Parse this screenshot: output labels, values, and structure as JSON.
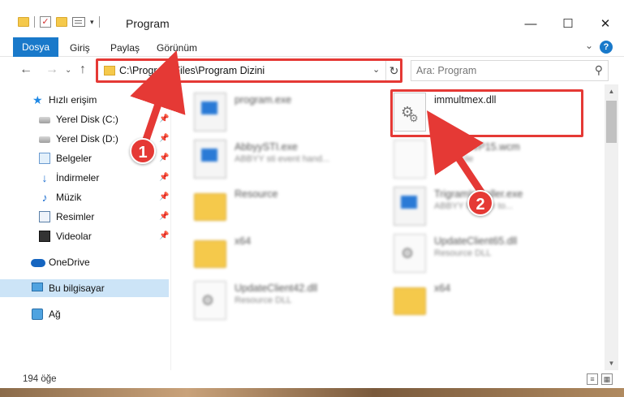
{
  "window": {
    "title": "Program",
    "minimize": "—",
    "maximize": "☐",
    "close": "✕"
  },
  "ribbon": {
    "tabs": [
      "Dosya",
      "Giriş",
      "Paylaş",
      "Görünüm"
    ],
    "help": "?"
  },
  "navigation": {
    "address_path": "C:\\Program Files\\Program Dizini",
    "search_placeholder": "Ara: Program"
  },
  "sidebar": {
    "items": [
      {
        "label": "Hızlı erişim",
        "icon": "star-icon",
        "pinned": false
      },
      {
        "label": "Yerel Disk (C:)",
        "icon": "drive-icon",
        "pinned": true
      },
      {
        "label": "Yerel Disk (D:)",
        "icon": "drive-icon",
        "pinned": true
      },
      {
        "label": "Belgeler",
        "icon": "documents-icon",
        "pinned": true
      },
      {
        "label": "İndirmeler",
        "icon": "download-icon",
        "pinned": true
      },
      {
        "label": "Müzik",
        "icon": "music-icon",
        "pinned": true
      },
      {
        "label": "Resimler",
        "icon": "pictures-icon",
        "pinned": true
      },
      {
        "label": "Videolar",
        "icon": "videos-icon",
        "pinned": true
      },
      {
        "label": "OneDrive",
        "icon": "cloud-icon",
        "pinned": false
      },
      {
        "label": "Bu bilgisayar",
        "icon": "computer-icon",
        "pinned": false,
        "selected": true
      },
      {
        "label": "Ağ",
        "icon": "network-icon",
        "pinned": false
      }
    ]
  },
  "files": [
    {
      "name": "program.exe",
      "desc": "",
      "icon": "exe-icon",
      "blurred": true
    },
    {
      "name": "immultmex.dll",
      "desc": "",
      "icon": "dll-icon",
      "blurred": false,
      "highlighted": true
    },
    {
      "name": "AbbyySTI.exe",
      "desc": "ABBYY sti event hand...",
      "icon": "exe-icon",
      "blurred": true
    },
    {
      "name": "TrigramWP15.wcm",
      "desc": "WCM File",
      "icon": "blank-file-icon",
      "blurred": true
    },
    {
      "name": "Resource",
      "desc": "",
      "icon": "folder-icon",
      "blurred": true
    },
    {
      "name": "TrigramInstaller.exe",
      "desc": "ABBYY Reader to...",
      "icon": "exe-icon",
      "blurred": true
    },
    {
      "name": "x64",
      "desc": "",
      "icon": "folder-icon",
      "blurred": true
    },
    {
      "name": "UpdateClient65.dll",
      "desc": "Resource DLL",
      "icon": "dll-icon",
      "blurred": true
    },
    {
      "name": "UpdateClient42.dll",
      "desc": "Resource DLL",
      "icon": "dll-icon",
      "blurred": true
    },
    {
      "name": "x64",
      "desc": "",
      "icon": "folder-icon",
      "blurred": true
    }
  ],
  "status": {
    "item_count": "194 öğe"
  },
  "annotations": {
    "step1": "1",
    "step2": "2",
    "accent_color": "#e53935"
  },
  "colors": {
    "file_tab": "#1979ca",
    "selected_bg": "#cce4f7"
  }
}
